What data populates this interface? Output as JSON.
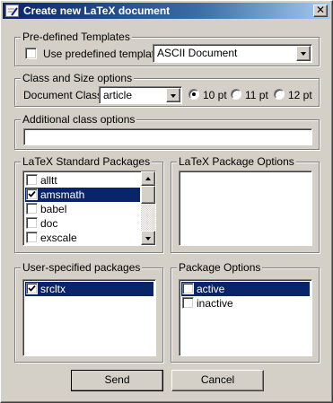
{
  "window": {
    "title": "Create new LaTeX document",
    "close_glyph": "✕"
  },
  "templates": {
    "legend": "Pre-defined Templates",
    "use_label": "Use predefined template:",
    "use_checked": false,
    "selected": "ASCII Document"
  },
  "class_size": {
    "legend": "Class and Size options",
    "class_label": "Document Class:",
    "class_value": "article",
    "sizes": [
      {
        "label": "10 pt",
        "selected": true
      },
      {
        "label": "11 pt",
        "selected": false
      },
      {
        "label": "12 pt",
        "selected": false
      }
    ]
  },
  "additional": {
    "legend": "Additional class options",
    "value": ""
  },
  "standard_packages": {
    "legend": "LaTeX Standard Packages",
    "items": [
      {
        "label": "alltt",
        "checked": false,
        "selected": false
      },
      {
        "label": "amsmath",
        "checked": true,
        "selected": true
      },
      {
        "label": "babel",
        "checked": false,
        "selected": false
      },
      {
        "label": "doc",
        "checked": false,
        "selected": false
      },
      {
        "label": "exscale",
        "checked": false,
        "selected": false
      }
    ]
  },
  "package_options": {
    "legend": "LaTeX Package Options"
  },
  "user_packages": {
    "legend": "User-specified packages",
    "items": [
      {
        "label": "srcltx",
        "checked": true,
        "selected": true
      }
    ]
  },
  "user_package_options": {
    "legend": "Package Options",
    "items": [
      {
        "label": "active",
        "checked": false,
        "selected": true
      },
      {
        "label": "inactive",
        "checked": false,
        "selected": false
      }
    ]
  },
  "buttons": {
    "send": "Send",
    "cancel": "Cancel"
  },
  "icons": {
    "app": "document-pen-icon",
    "close": "close-icon",
    "dropdown": "chevron-down-icon",
    "scroll_up": "arrow-up-icon",
    "scroll_down": "arrow-down-icon",
    "check": "check-mark-icon"
  }
}
